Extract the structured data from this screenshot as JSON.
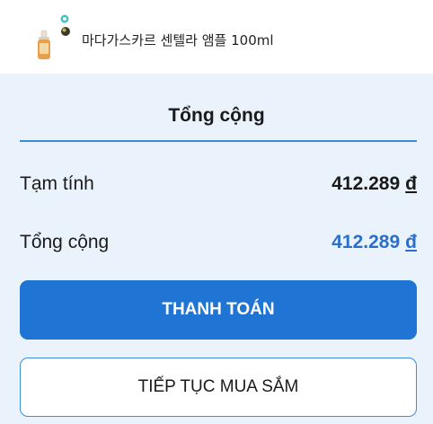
{
  "product": {
    "name": "마다가스카르 센텔라 앰플 100ml",
    "image_icon": "ampoule-bottle-icon"
  },
  "summary": {
    "title": "Tổng cộng",
    "subtotal_label": "Tạm tính",
    "subtotal_value": "412.289",
    "total_label": "Tổng cộng",
    "total_value": "412.289",
    "currency": "đ"
  },
  "buttons": {
    "pay_label": "THANH TOÁN",
    "continue_label": "TIẾP TỤC MUA SẮM"
  },
  "colors": {
    "accent": "#2075d4",
    "total_value": "#2a6fc9",
    "panel_bg": "#eaf3fc",
    "divider": "#3b8dd8"
  }
}
